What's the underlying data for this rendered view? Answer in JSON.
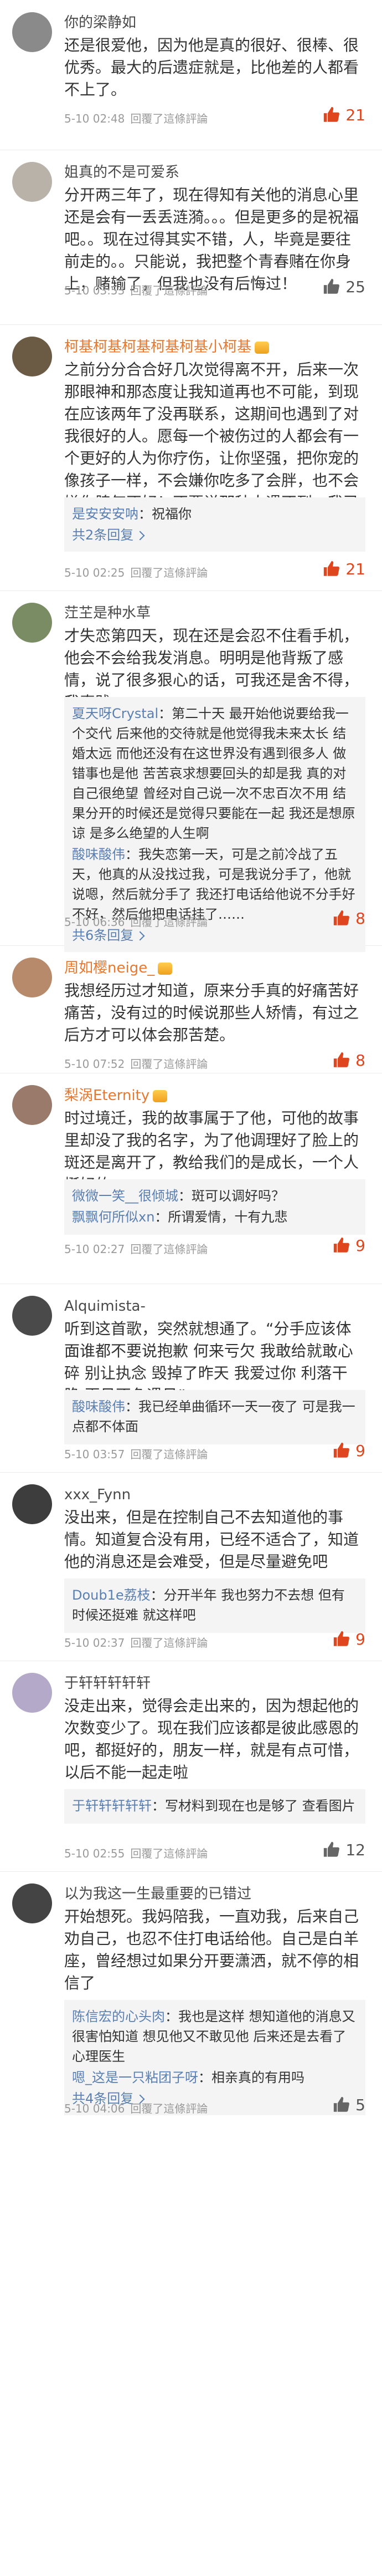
{
  "comments": [
    {
      "name": "你的梁静如",
      "vip": false,
      "text": "还是很爱他，因为他是真的很好、很棒、很优秀。最大的后遗症就是，比他差的人都看不上了。",
      "time": "5-10 02:48",
      "action": "回覆了這條評論",
      "likes": "21",
      "hot": true,
      "avatar_color": "#8a8a8a",
      "replies": [],
      "more": ""
    },
    {
      "name": "姐真的不是可爱系",
      "vip": false,
      "text": "分开两三年了，现在得知有关他的消息心里还是会有一丢丢涟漪。。。但是更多的是祝福吧。。现在过得其实不错，人，毕竟是要往前走的。。只能说，我把整个青春赌在你身上，赌输了，但我也没有后悔过！",
      "time": "5-10 03:53",
      "action": "回覆了這條評論",
      "likes": "25",
      "hot": false,
      "avatar_color": "#b9b2a8",
      "replies": [],
      "more": ""
    },
    {
      "name": "柯基柯基柯基柯基柯基小柯基",
      "vip": true,
      "text": "之前分分合合好几次觉得离不开，后来一次那眼神和那态度让我知道再也不可能，到现在应该两年了没再联系，这期间也遇到了对我很好的人。愿每一个被伤过的人都会有一个更好的人为你疗伤，让你坚强，把你宠的像孩子一样，不会嫌你吃多了会胖，也不会嫌你脾气不好！不要说那种人遇不到，我已经遇到了！",
      "time": "5-10 02:25",
      "action": "回覆了這條評論",
      "likes": "21",
      "hot": true,
      "avatar_color": "#6b5a44",
      "replies": [
        {
          "name": "是安安安呐",
          "text": "祝福你"
        }
      ],
      "more": "共2条回复"
    },
    {
      "name": "茳芏是种水草",
      "vip": false,
      "text": "才失恋第四天，现在还是会忍不住看手机，他会不会给我发消息。明明是他背叛了感情，说了很多狠心的话，可我还是舍不得，我真贱……",
      "time": "5-10 06:36",
      "action": "回覆了這條評論",
      "likes": "8",
      "hot": true,
      "avatar_color": "#7a8c63",
      "replies": [
        {
          "name": "夏天呀Crystal",
          "text": "第二十天 最开始他说要给我一个交代 后来他的交待就是他觉得我未来太长 结婚太远 而他还没有在这世界没有遇到很多人 做错事也是他 苦苦哀求想要回头的却是我 真的对自己很绝望 曾经对自己说一次不忠百次不用 结果分开的时候还是觉得只要能在一起 我还是想原谅 是多么绝望的人生啊"
        },
        {
          "name": "酸味酸伟",
          "text": "我失恋第一天，可是之前冷战了五天，他真的从没找过我，可是我说分手了，他就说嗯，然后就分手了 我还打电话给他说不分手好不好，然后他把电话挂了……"
        }
      ],
      "more": "共6条回复"
    },
    {
      "name": "周如樱neige_",
      "vip": true,
      "text": "我想经历过才知道，原来分手真的好痛苦好痛苦，没有过的时候说那些人矫情，有过之后方才可以体会那苦楚。",
      "time": "5-10 07:52",
      "action": "回覆了這條評論",
      "likes": "8",
      "hot": true,
      "avatar_color": "#b78a6b",
      "replies": [],
      "more": ""
    },
    {
      "name": "梨涡Eternity",
      "vip": true,
      "text": "时过境迁，我的故事属于了他，可他的故事里却没了我的名字，为了他调理好了脸上的斑还是离开了，教给我们的是成长，一个人挺好的",
      "time": "5-10 02:27",
      "action": "回覆了這條評論",
      "likes": "9",
      "hot": true,
      "avatar_color": "#9a7a6b",
      "replies": [
        {
          "name": "微微一笑__很倾城",
          "text": "斑可以调好吗？"
        },
        {
          "name": "飘飘何所似xn",
          "text": "所谓爱情，十有九悲"
        }
      ],
      "more": ""
    },
    {
      "name": "Alquimista-",
      "vip": false,
      "text": "听到这首歌，突然就想通了。“分手应该体面谁都不要说抱歉 何来亏欠 我敢给就敢心碎 别让执念 毁掉了昨天 我爱过你 利落干脆 再见不负遇见”",
      "time": "5-10 03:57",
      "action": "回覆了這條評論",
      "likes": "9",
      "hot": true,
      "avatar_color": "#4a4a4a",
      "replies": [
        {
          "name": "酸味酸伟",
          "text": "我已经单曲循环一天一夜了 可是我一点都不体面"
        }
      ],
      "more": ""
    },
    {
      "name": "xxx_Fynn",
      "vip": false,
      "text": "没出来，但是在控制自己不去知道他的事情。知道复合没有用，已经不适合了，知道他的消息还是会难受，但是尽量避免吧",
      "time": "5-10 02:37",
      "action": "回覆了這條評論",
      "likes": "9",
      "hot": true,
      "avatar_color": "#3d3d3d",
      "replies": [
        {
          "name": "Doub1e荔枝",
          "text": "分开半年 我也努力不去想 但有时候还挺难 就这样吧"
        }
      ],
      "more": ""
    },
    {
      "name": "于轩轩轩轩轩",
      "vip": false,
      "text": "没走出来，觉得会走出来的，因为想起他的次数变少了。现在我们应该都是彼此感恩的吧，都挺好的，朋友一样，就是有点可惜，以后不能一起走啦",
      "time": "5-10 02:55",
      "action": "回覆了這條評論",
      "likes": "12",
      "hot": false,
      "avatar_color": "#b5a9c9",
      "replies": [
        {
          "name": "于轩轩轩轩轩",
          "text": "写材料到现在也是够了 查看图片"
        }
      ],
      "more": ""
    },
    {
      "name": "以为我这一生最重要的已错过",
      "vip": false,
      "text": "开始想死。我妈陪我，一直劝我，后来自己劝自己，也忍不住打电话给他。自己是白羊座，曾经想过如果分开要潇洒，就不停的相信了",
      "time": "5-10 04:06",
      "action": "回覆了這條評論",
      "likes": "5",
      "hot": false,
      "avatar_color": "#444444",
      "replies": [
        {
          "name": "陈信宏的心头肉",
          "text": "我也是这样 想知道他的消息又很害怕知道 想见他又不敢见他 后来还是去看了心理医生"
        },
        {
          "name": "嗯_这是一只粘团子呀",
          "text": "相亲真的有用吗"
        }
      ],
      "more": "共4条回复"
    }
  ]
}
